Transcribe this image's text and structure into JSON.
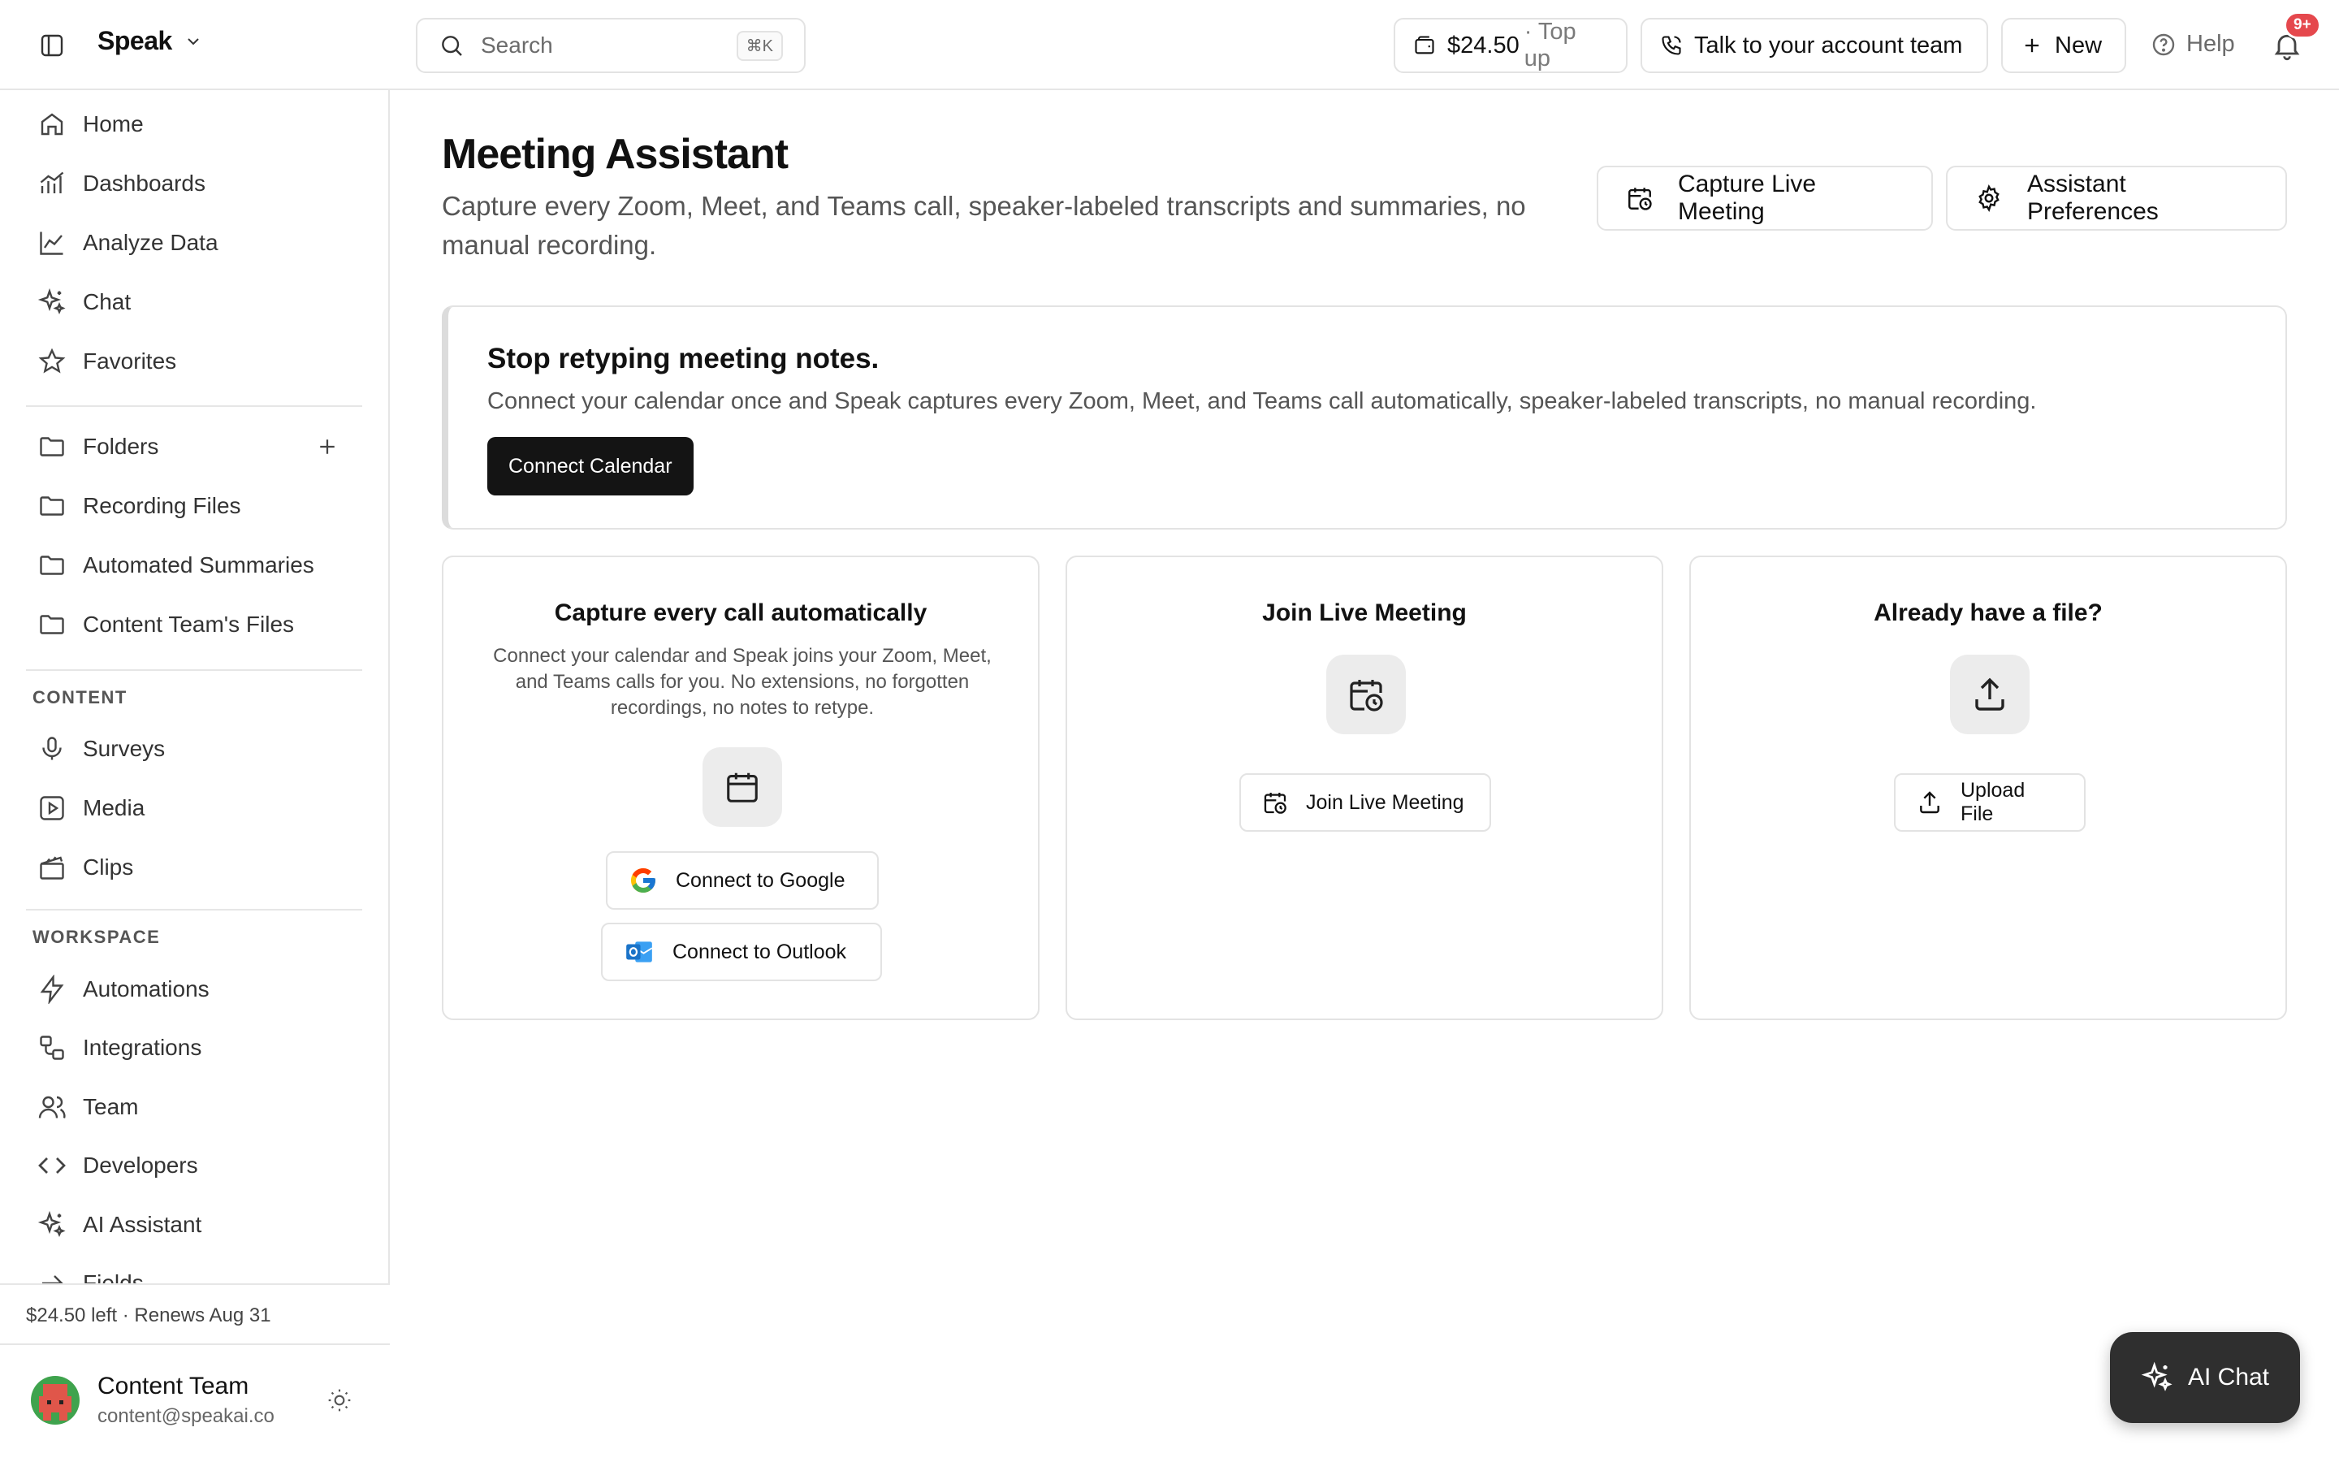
{
  "app": {
    "brand": "Speak"
  },
  "search": {
    "placeholder": "Search",
    "shortcut": "⌘K"
  },
  "topbar": {
    "balance_amount": "$24.50",
    "balance_action": "· Top up",
    "talk_label": "Talk to your account team",
    "new_label": "New",
    "help_label": "Help",
    "notifications_badge": "9+"
  },
  "sidebar": {
    "primary": [
      {
        "label": "Home",
        "icon": "home-icon"
      },
      {
        "label": "Dashboards",
        "icon": "bar-chart-icon"
      },
      {
        "label": "Analyze Data",
        "icon": "line-chart-icon"
      },
      {
        "label": "Chat",
        "icon": "sparkles-icon"
      },
      {
        "label": "Favorites",
        "icon": "star-icon"
      }
    ],
    "folders_label": "Folders",
    "folders": [
      {
        "label": "Recording Files",
        "icon": "folder-icon"
      },
      {
        "label": "Automated Summaries",
        "icon": "folder-icon"
      },
      {
        "label": "Content Team's Files",
        "icon": "folder-icon"
      }
    ],
    "content_heading": "CONTENT",
    "content": [
      {
        "label": "Surveys",
        "icon": "microphone-icon"
      },
      {
        "label": "Media",
        "icon": "play-square-icon"
      },
      {
        "label": "Clips",
        "icon": "clapperboard-icon"
      }
    ],
    "workspace_heading": "WORKSPACE",
    "workspace": [
      {
        "label": "Automations",
        "icon": "lightning-icon"
      },
      {
        "label": "Integrations",
        "icon": "integrations-icon"
      },
      {
        "label": "Team",
        "icon": "users-icon"
      },
      {
        "label": "Developers",
        "icon": "code-icon"
      },
      {
        "label": "AI Assistant",
        "icon": "sparkles-icon"
      },
      {
        "label": "Fields",
        "icon": "arrow-right-icon"
      }
    ],
    "plan_text": "$24.50 left · Renews Aug 31",
    "user_name": "Content Team",
    "user_email": "content@speakai.co"
  },
  "main": {
    "title": "Meeting Assistant",
    "subtitle": "Capture every Zoom, Meet, and Teams call, speaker-labeled transcripts and summaries, no manual recording.",
    "capture_button": "Capture Live Meeting",
    "preferences_button": "Assistant Preferences",
    "banner": {
      "title": "Stop retyping meeting notes.",
      "text": "Connect your calendar once and Speak captures every Zoom, Meet, and Teams call automatically, speaker-labeled transcripts, no manual recording.",
      "button": "Connect Calendar"
    },
    "cards": [
      {
        "title": "Capture every call automatically",
        "description": "Connect your calendar and Speak joins your Zoom, Meet, and Teams calls for you. No extensions, no forgotten recordings, no notes to retype.",
        "buttons": [
          "Connect to Google",
          "Connect to Outlook"
        ]
      },
      {
        "title": "Join Live Meeting",
        "buttons": [
          "Join Live Meeting"
        ]
      },
      {
        "title": "Already have a file?",
        "buttons": [
          "Upload File"
        ]
      }
    ]
  },
  "ai_chat_label": "AI Chat",
  "colors": {
    "primary_button": "#141414",
    "badge": "#e5484d",
    "ai_chat_bg": "#2f2f2f",
    "icon_tile": "#ececec",
    "border": "#e3e3e3"
  }
}
